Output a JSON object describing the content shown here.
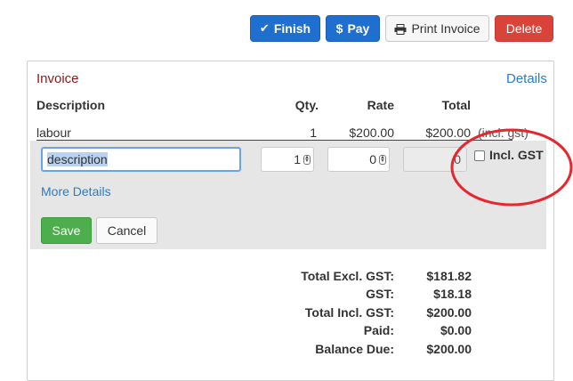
{
  "toolbar": {
    "finish_label": "Finish",
    "pay_label": "Pay",
    "print_label": "Print Invoice",
    "delete_label": "Delete"
  },
  "invoice": {
    "title": "Invoice",
    "details_link": "Details",
    "columns": {
      "description": "Description",
      "qty": "Qty.",
      "rate": "Rate",
      "total": "Total"
    },
    "line_item": {
      "description": "labour",
      "qty": "1",
      "rate": "$200.00",
      "total": "$200.00",
      "note": "(incl. gst)"
    },
    "edit_row": {
      "description_value": "description",
      "qty_value": "1",
      "rate_value": "0",
      "total_value": "0",
      "incl_gst_label": "Incl. GST",
      "incl_gst_checked": false,
      "more_details_link": "More Details",
      "save_label": "Save",
      "cancel_label": "Cancel"
    },
    "totals": [
      {
        "label": "Total Excl. GST:",
        "value": "$181.82"
      },
      {
        "label": "GST:",
        "value": "$18.18"
      },
      {
        "label": "Total Incl. GST:",
        "value": "$200.00"
      },
      {
        "label": "Paid:",
        "value": "$0.00"
      },
      {
        "label": "Balance Due:",
        "value": "$200.00"
      }
    ]
  },
  "colors": {
    "primary": "#1f6fd0",
    "danger": "#d9433a",
    "success": "#4cae4c",
    "link": "#2a7cc7",
    "title": "#8b1a1a",
    "annotation": "#e8262d"
  }
}
